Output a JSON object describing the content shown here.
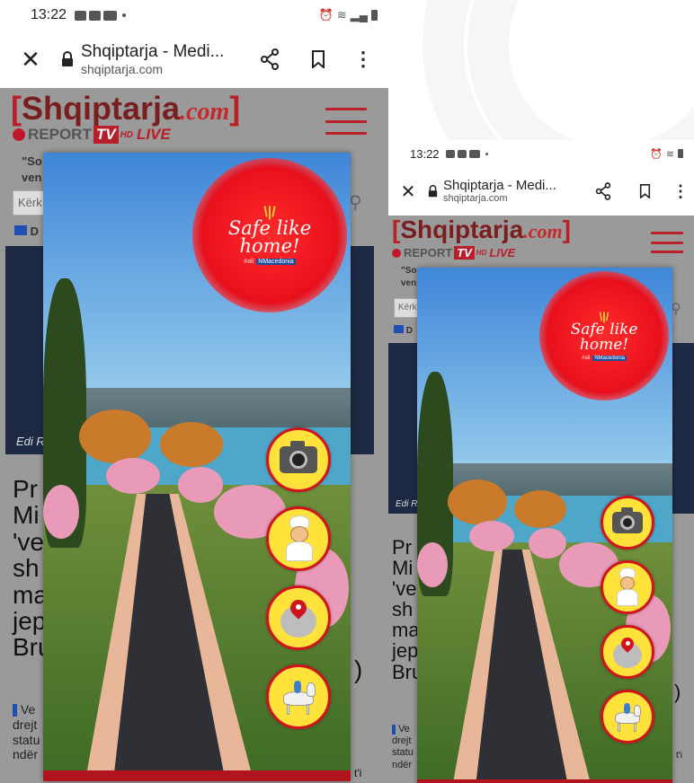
{
  "status_bar": {
    "time": "13:22"
  },
  "browser": {
    "page_title": "Shqiptarja - Medi...",
    "domain": "shqiptarja.com"
  },
  "site": {
    "logo_open": "[",
    "logo_main": "Shqiptarja",
    "logo_com": ".com",
    "logo_close": "]",
    "report_text": "REPORT",
    "tv_text": "TV",
    "hd_text": "HD",
    "live_text": "LIVE",
    "snippet_line1": "\"So",
    "snippet_line2": "ven",
    "search_placeholder": "Kërk",
    "section_mark": "D",
    "image_caption": "Edi R",
    "headline_lines": [
      "Pr",
      "Mi",
      "'ve",
      "sh",
      "ma",
      "jep",
      "Bru"
    ],
    "headline_edge": ")",
    "body_lines": [
      "Ve",
      "drejt",
      "statu",
      "ndër"
    ],
    "body_edge": "t'i"
  },
  "ad": {
    "sun_rays": "\\|/",
    "slogan_line1": "Safe like",
    "slogan_line2": "home!",
    "hashtag": "#all",
    "country_tag": "NMacedonia",
    "buttons": [
      {
        "icon": "camera-icon"
      },
      {
        "icon": "chef-icon"
      },
      {
        "icon": "map-pin-icon"
      },
      {
        "icon": "horse-rider-icon"
      }
    ]
  }
}
